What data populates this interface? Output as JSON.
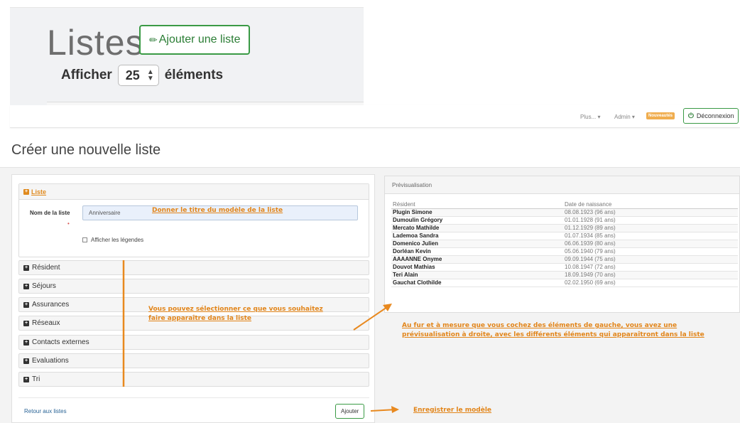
{
  "top_crop": {
    "title": "Listes",
    "add_list_button": "Ajouter une liste",
    "show_label": "Afficher",
    "page_size": "25",
    "elements_label": "éléments"
  },
  "navbar": {
    "plus_menu": "Plus... ▾",
    "admin_menu": "Admin ▾",
    "news_badge": "Nouveautés",
    "logout": "Déconnexion"
  },
  "page": {
    "title": "Créer une nouvelle liste"
  },
  "form": {
    "section_title": "Liste",
    "name_label": "Nom de la liste",
    "required_mark": "•",
    "name_value": "Anniversaire",
    "show_legends_label": "Afficher les légendes",
    "accordion": [
      {
        "label": "Résident"
      },
      {
        "label": "Séjours"
      },
      {
        "label": "Assurances"
      },
      {
        "label": "Réseaux"
      },
      {
        "label": "Contacts externes"
      },
      {
        "label": "Evaluations"
      },
      {
        "label": "Tri"
      }
    ],
    "back_link": "Retour aux listes",
    "submit_button": "Ajouter"
  },
  "preview": {
    "title": "Prévisualisation",
    "columns": [
      "Résident",
      "Date de naissance"
    ],
    "rows": [
      [
        "Plugin Simone",
        "08.08.1923 (96 ans)"
      ],
      [
        "Dumoulin Grégory",
        "01.01.1928 (91 ans)"
      ],
      [
        "Mercato Mathilde",
        "01.12.1929 (89 ans)"
      ],
      [
        "Lademoa Sandra",
        "01.07.1934 (85 ans)"
      ],
      [
        "Domenico Julien",
        "06.06.1939 (80 ans)"
      ],
      [
        "Dorléan Kevin",
        "05.06.1940 (79 ans)"
      ],
      [
        "AAAANNE Onyme",
        "09.09.1944 (75 ans)"
      ],
      [
        "Douvot Mathias",
        "10.08.1947 (72 ans)"
      ],
      [
        "Teri Alain",
        "18.09.1949 (70 ans)"
      ],
      [
        "Gauchat Clothilde",
        "02.02.1950 (69 ans)"
      ]
    ]
  },
  "annotations": {
    "title_note": "Donner le titre du modèle de la liste",
    "select_note_1": "Vous pouvez sélectionner ce que vous souhaitez",
    "select_note_2": "faire apparaître dans la liste",
    "preview_note_1": "Au fur et à mesure que vous cochez des éléments de gauche, vous avez une",
    "preview_note_2": "prévisualisation à droite, avec les différents éléments qui apparaîtront dans la liste",
    "save_note": "Enregistrer le modèle"
  },
  "colors": {
    "accent_green": "#3a9a45",
    "annotation_orange": "#e2851a",
    "badge_orange": "#f0ad4e"
  }
}
